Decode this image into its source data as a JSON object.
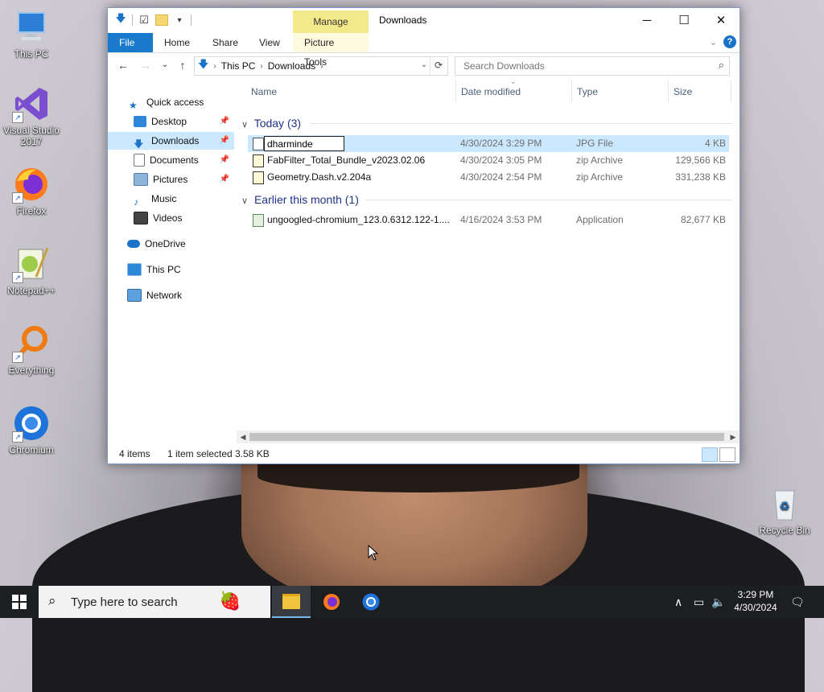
{
  "desktop": {
    "icons": [
      {
        "label": "This PC"
      },
      {
        "label": "Visual Studio 2017"
      },
      {
        "label": "Firefox"
      },
      {
        "label": "Notepad++"
      },
      {
        "label": "Everything"
      },
      {
        "label": "Chromium"
      },
      {
        "label": "Recycle Bin"
      }
    ]
  },
  "window": {
    "title": "Downloads",
    "context_tab_group": "Manage",
    "ribbon_tabs": [
      "File",
      "Home",
      "Share",
      "View",
      "Picture Tools"
    ],
    "window_controls": {
      "minimize": "─",
      "maximize": "☐",
      "close": "✕"
    }
  },
  "navigation": {
    "breadcrumb": [
      "This PC",
      "Downloads"
    ],
    "search_placeholder": "Search Downloads"
  },
  "sidebar": {
    "items": [
      {
        "label": "Quick access"
      },
      {
        "label": "Desktop"
      },
      {
        "label": "Downloads"
      },
      {
        "label": "Documents"
      },
      {
        "label": "Pictures"
      },
      {
        "label": "Music"
      },
      {
        "label": "Videos"
      },
      {
        "label": "OneDrive"
      },
      {
        "label": "This PC"
      },
      {
        "label": "Network"
      }
    ]
  },
  "file_list": {
    "columns": [
      "Name",
      "Date modified",
      "Type",
      "Size"
    ],
    "groups": [
      {
        "title": "Today (3)",
        "files": [
          {
            "name": "dharminde",
            "date": "4/30/2024 3:29 PM",
            "type": "JPG File",
            "size": "4 KB"
          },
          {
            "name": "FabFilter_Total_Bundle_v2023.02.06",
            "date": "4/30/2024 3:05 PM",
            "type": "zip Archive",
            "size": "129,566 KB"
          },
          {
            "name": "Geometry.Dash.v2.204a",
            "date": "4/30/2024 2:54 PM",
            "type": "zip Archive",
            "size": "331,238 KB"
          }
        ]
      },
      {
        "title": "Earlier this month (1)",
        "files": [
          {
            "name": "ungoogled-chromium_123.0.6312.122-1....",
            "date": "4/16/2024 3:53 PM",
            "type": "Application",
            "size": "82,677 KB"
          }
        ]
      }
    ]
  },
  "status": {
    "item_count": "4 items",
    "selection": "1 item selected",
    "selection_size": "3.58 KB"
  },
  "taskbar": {
    "search_placeholder": "Type here to search",
    "time": "3:29 PM",
    "date": "4/30/2024"
  },
  "colors": {
    "accent": "#1979ca",
    "selection": "#cce8ff",
    "context_tab": "#f4e98a",
    "taskbar": "#1d1e22"
  }
}
